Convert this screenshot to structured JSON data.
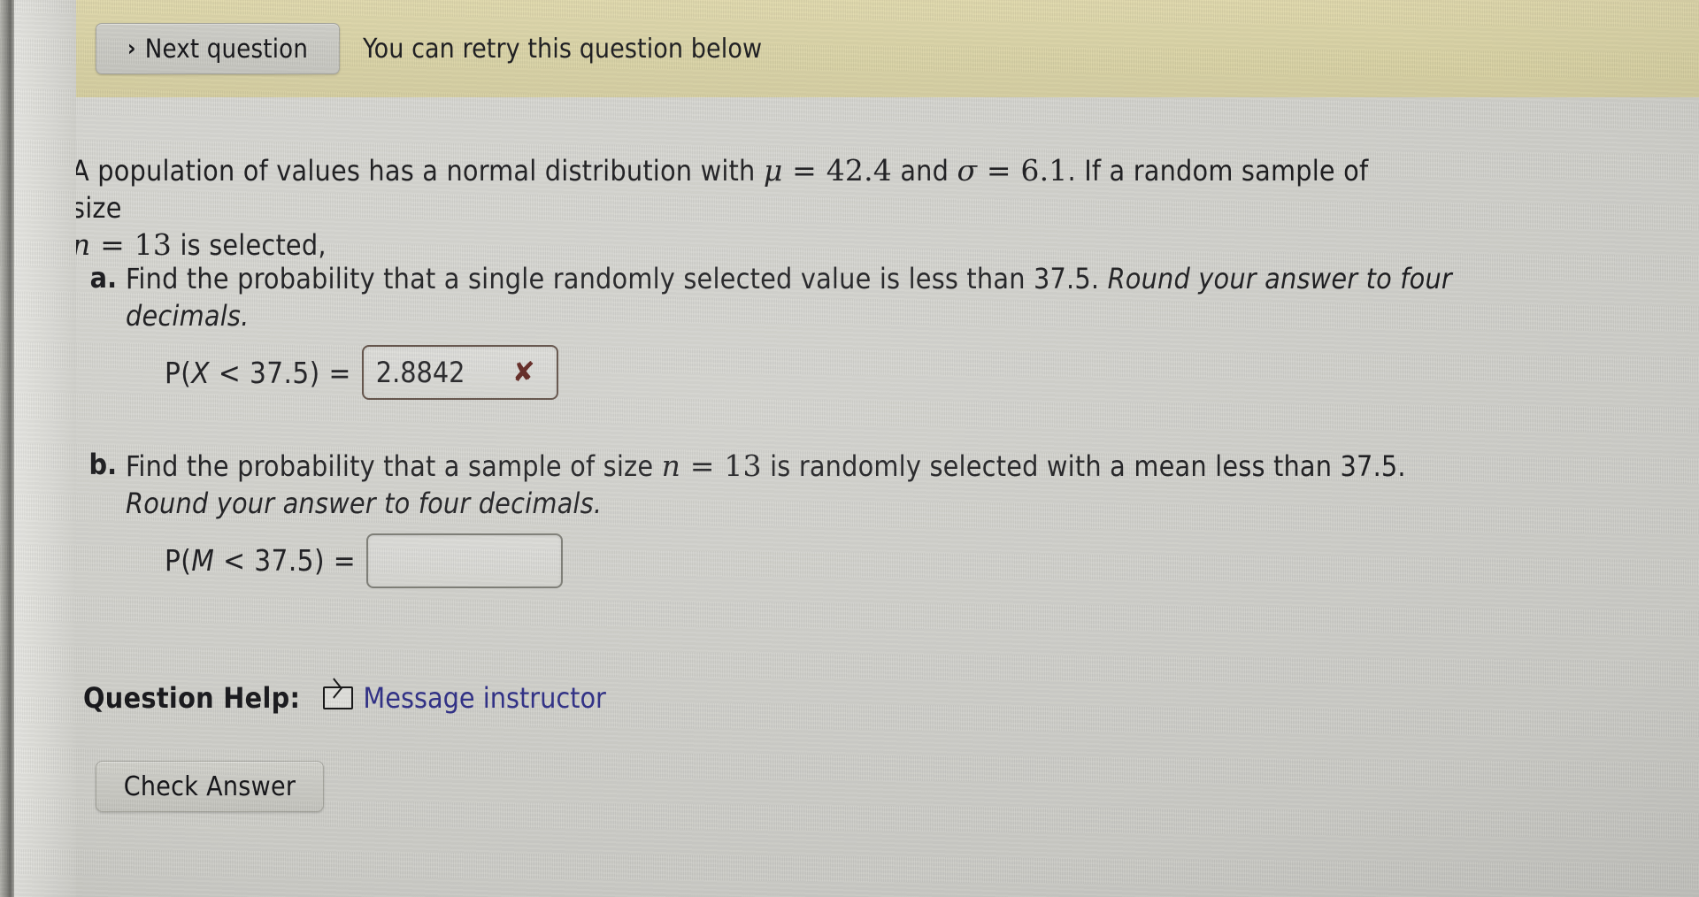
{
  "banner": {
    "next_question_button": "Next question",
    "next_question_chevron": "›",
    "retry_notice": "You can retry this question below"
  },
  "question": {
    "intro": {
      "line1_pre": "A population of values has a normal distribution with ",
      "mu_symbol": "μ",
      "mu_eq": " = ",
      "mu_value": "42.4",
      "and": " and ",
      "sigma_symbol": "σ",
      "sigma_eq": " = ",
      "sigma_value": "6.1",
      "line1_post": ". If a random sample of size",
      "n_symbol": "n",
      "n_eq": " = ",
      "n_value": "13",
      "line2_post": " is selected,"
    },
    "parts": [
      {
        "letter": "a.",
        "prompt_plain": "Find the probability that a single randomly selected value is less than 37.5. ",
        "prompt_italic": "Round your answer to four decimals.",
        "threshold": "37.5",
        "answer_label_pre": "P(",
        "answer_label_var": "X",
        "answer_label_post": " < 37.5) =",
        "answer_value": "2.8842",
        "status": "incorrect",
        "status_mark": "✘"
      },
      {
        "letter": "b.",
        "prompt_plain_1": "Find the probability that a sample of size ",
        "prompt_n_symbol": "n",
        "prompt_n_eq": " = ",
        "prompt_n_value": "13",
        "prompt_plain_2": " is randomly selected with a mean less than 37.5. ",
        "prompt_italic": "Round your answer to four decimals.",
        "answer_label_pre": "P(",
        "answer_label_var": "M",
        "answer_label_post": " < 37.5) =",
        "answer_value": "",
        "answer_placeholder": ""
      }
    ]
  },
  "help": {
    "label": "Question Help:",
    "message_instructor_link": "Message instructor",
    "envelope_icon": "envelope-icon"
  },
  "actions": {
    "check_answer_button": "Check Answer"
  },
  "colors": {
    "banner_background": "#ddd6a9",
    "page_background": "#d5d5d0",
    "link_color": "#2b2b86",
    "incorrect_mark": "#5a1a14",
    "answer_box_border_active": "#5c4a40",
    "answer_box_border_empty": "#7a7a72",
    "text_color": "#17171a"
  }
}
